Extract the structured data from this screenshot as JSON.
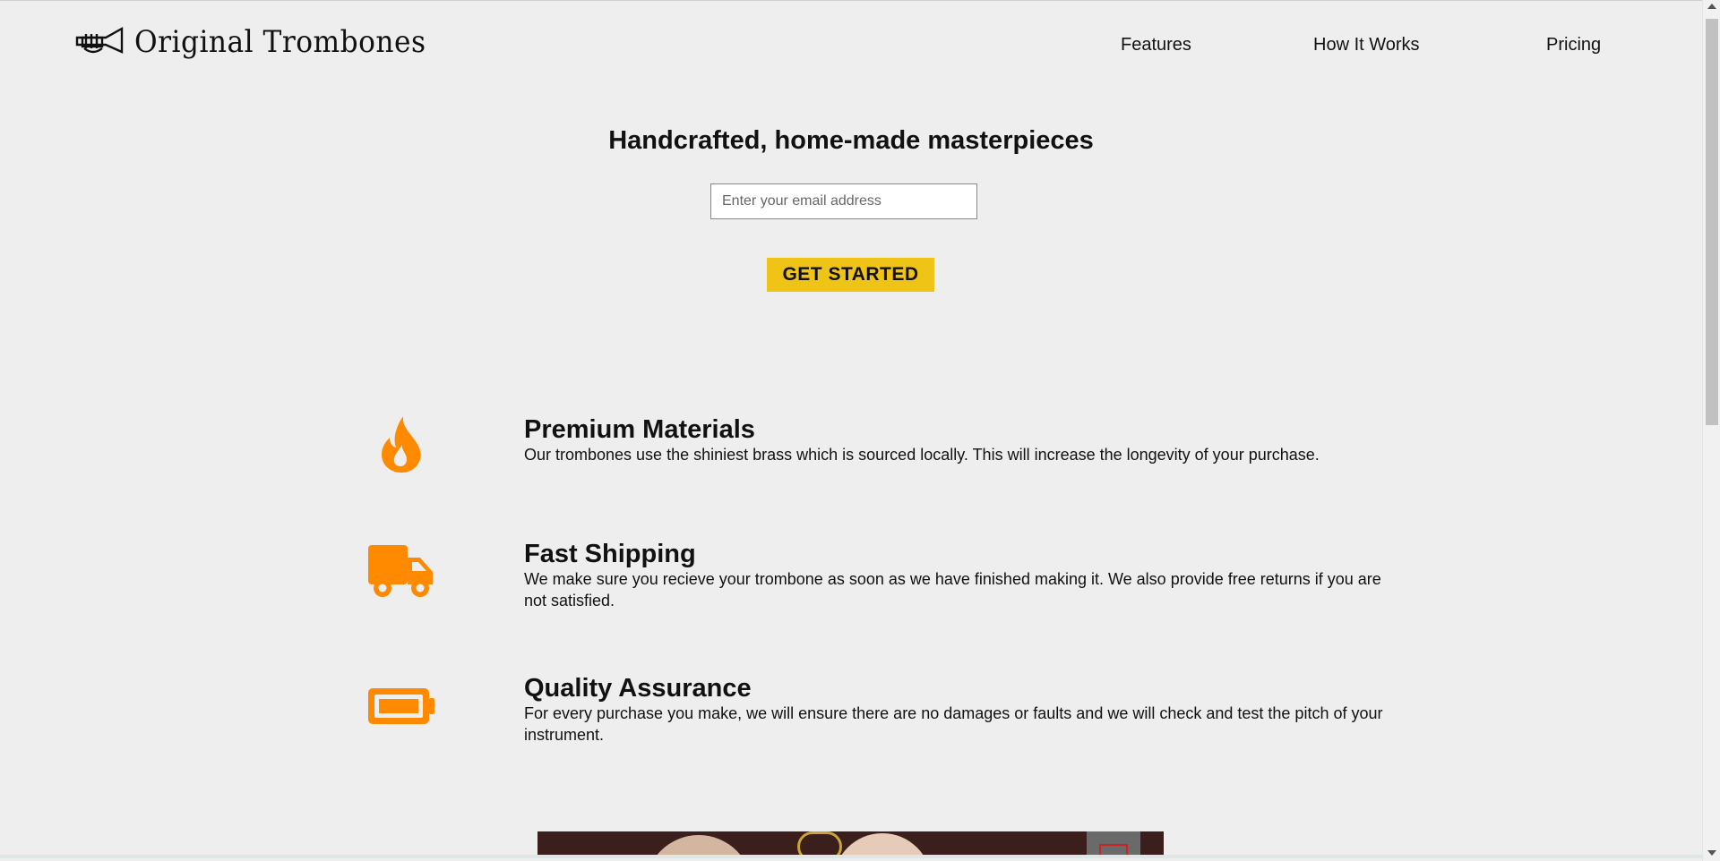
{
  "header": {
    "brand": "Original Trombones",
    "logo_icon": "trumpet-icon",
    "nav": [
      {
        "label": "Features"
      },
      {
        "label": "How It Works"
      },
      {
        "label": "Pricing"
      }
    ]
  },
  "hero": {
    "title": "Handcrafted, home-made masterpieces",
    "email_placeholder": "Enter your email address",
    "email_value": "",
    "cta_label": "GET STARTED"
  },
  "features": [
    {
      "icon": "fire-icon",
      "title": "Premium Materials",
      "description": "Our trombones use the shiniest brass which is sourced locally. This will increase the longevity of your purchase."
    },
    {
      "icon": "truck-icon",
      "title": "Fast Shipping",
      "description": "We make sure you recieve your trombone as soon as we have finished making it. We also provide free returns if you are not satisfied."
    },
    {
      "icon": "battery-icon",
      "title": "Quality Assurance",
      "description": "For every purchase you make, we will ensure there are no damages or faults and we will check and test the pitch of your instrument."
    }
  ],
  "colors": {
    "background": "#eeeeee",
    "accent_yellow": "#f0c416",
    "icon_orange": "#ff8a00",
    "text": "#111111"
  }
}
